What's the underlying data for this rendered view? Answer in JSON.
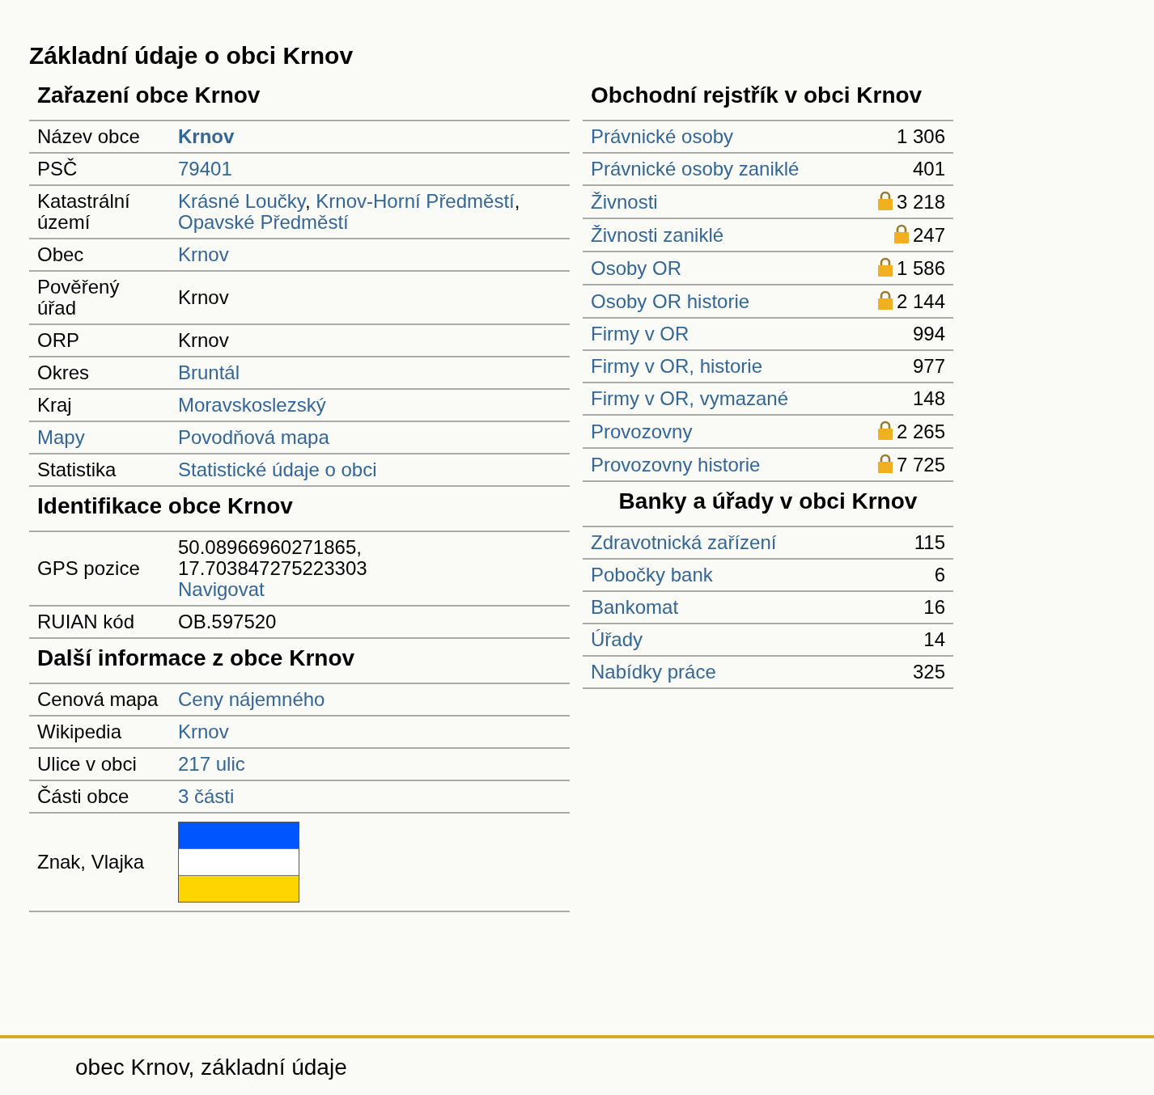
{
  "title": "Základní údaje o obci Krnov",
  "left_sections": [
    {
      "title": "Zařazení obce Krnov",
      "rows": [
        {
          "label": {
            "text": "Název obce",
            "link": false
          },
          "lines": [
            [
              {
                "text": "Krnov",
                "link": true,
                "bold": true
              }
            ]
          ]
        },
        {
          "label": {
            "text": "PSČ",
            "link": false
          },
          "lines": [
            [
              {
                "text": "79401",
                "link": true,
                "bold": false
              }
            ]
          ]
        },
        {
          "label": {
            "text": "Katastrální území",
            "link": false
          },
          "lines": [
            [
              {
                "text": "Krásné Loučky",
                "link": true,
                "bold": false
              },
              {
                "text": ", ",
                "link": false,
                "bold": false
              },
              {
                "text": "Krnov-Horní Předměstí",
                "link": true,
                "bold": false
              },
              {
                "text": ",",
                "link": false,
                "bold": false
              }
            ],
            [
              {
                "text": "Opavské Předměstí",
                "link": true,
                "bold": false
              }
            ]
          ]
        },
        {
          "label": {
            "text": "Obec",
            "link": false
          },
          "lines": [
            [
              {
                "text": "Krnov",
                "link": true,
                "bold": false
              }
            ]
          ]
        },
        {
          "label": {
            "text": "Pověřený úřad",
            "link": false
          },
          "lines": [
            [
              {
                "text": "Krnov",
                "link": false,
                "bold": false
              }
            ]
          ]
        },
        {
          "label": {
            "text": "ORP",
            "link": false
          },
          "lines": [
            [
              {
                "text": "Krnov",
                "link": false,
                "bold": false
              }
            ]
          ]
        },
        {
          "label": {
            "text": "Okres",
            "link": false
          },
          "lines": [
            [
              {
                "text": "Bruntál",
                "link": true,
                "bold": false
              }
            ]
          ]
        },
        {
          "label": {
            "text": "Kraj",
            "link": false
          },
          "lines": [
            [
              {
                "text": "Moravskoslezský",
                "link": true,
                "bold": false
              }
            ]
          ]
        },
        {
          "label": {
            "text": "Mapy",
            "link": true
          },
          "lines": [
            [
              {
                "text": "Povodňová mapa",
                "link": true,
                "bold": false
              }
            ]
          ]
        },
        {
          "label": {
            "text": "Statistika",
            "link": false
          },
          "lines": [
            [
              {
                "text": "Statistické údaje o obci",
                "link": true,
                "bold": false
              }
            ]
          ]
        }
      ]
    },
    {
      "title": "Identifikace obce Krnov",
      "rows": [
        {
          "label": {
            "text": "GPS pozice",
            "link": false
          },
          "lines": [
            [
              {
                "text": "50.08966960271865,",
                "link": false,
                "bold": false
              }
            ],
            [
              {
                "text": "17.703847275223303",
                "link": false,
                "bold": false
              }
            ],
            [
              {
                "text": "Navigovat",
                "link": true,
                "bold": false
              }
            ]
          ]
        },
        {
          "label": {
            "text": "RUIAN kód",
            "link": false
          },
          "lines": [
            [
              {
                "text": "OB.597520",
                "link": false,
                "bold": false
              }
            ]
          ]
        }
      ]
    },
    {
      "title": "Další informace z obce Krnov",
      "rows": [
        {
          "label": {
            "text": "Cenová mapa",
            "link": false
          },
          "lines": [
            [
              {
                "text": "Ceny nájemného",
                "link": true,
                "bold": false
              }
            ]
          ]
        },
        {
          "label": {
            "text": "Wikipedia",
            "link": false
          },
          "lines": [
            [
              {
                "text": "Krnov",
                "link": true,
                "bold": false
              }
            ]
          ]
        },
        {
          "label": {
            "text": "Ulice v obci",
            "link": false
          },
          "lines": [
            [
              {
                "text": "217 ulic",
                "link": true,
                "bold": false
              }
            ]
          ]
        },
        {
          "label": {
            "text": "Části obce",
            "link": false
          },
          "lines": [
            [
              {
                "text": "3 části",
                "link": true,
                "bold": false
              }
            ]
          ]
        },
        {
          "label": {
            "text": "Znak, Vlajka",
            "link": false
          },
          "flag": [
            {
              "color": "#0055ff"
            },
            {
              "color": "#ffffff"
            },
            {
              "color": "#ffd500"
            }
          ]
        }
      ]
    }
  ],
  "right_sections": [
    {
      "title": "Obchodní rejstřík v obci Krnov",
      "centered": false,
      "rows": [
        {
          "label": "Právnické osoby",
          "value": "1 306",
          "locked": false
        },
        {
          "label": "Právnické osoby zaniklé",
          "value": "401",
          "locked": false
        },
        {
          "label": "Živnosti",
          "value": "3 218",
          "locked": true
        },
        {
          "label": "Živnosti zaniklé",
          "value": "247",
          "locked": true
        },
        {
          "label": "Osoby OR",
          "value": "1 586",
          "locked": true
        },
        {
          "label": "Osoby OR historie",
          "value": "2 144",
          "locked": true
        },
        {
          "label": "Firmy v OR",
          "value": "994",
          "locked": false
        },
        {
          "label": "Firmy v OR, historie",
          "value": "977",
          "locked": false
        },
        {
          "label": "Firmy v OR, vymazané",
          "value": "148",
          "locked": false
        },
        {
          "label": "Provozovny",
          "value": "2 265",
          "locked": true
        },
        {
          "label": "Provozovny historie",
          "value": "7 725",
          "locked": true
        }
      ]
    },
    {
      "title": "Banky a úřady v obci Krnov",
      "centered": true,
      "rows": [
        {
          "label": "Zdravotnická zařízení",
          "value": "115",
          "locked": false
        },
        {
          "label": "Pobočky bank",
          "value": "6",
          "locked": false
        },
        {
          "label": "Bankomat",
          "value": "16",
          "locked": false
        },
        {
          "label": "Úřady",
          "value": "14",
          "locked": false
        },
        {
          "label": "Nabídky práce",
          "value": "325",
          "locked": false
        }
      ]
    }
  ],
  "footer": "obec Krnov, základní údaje"
}
